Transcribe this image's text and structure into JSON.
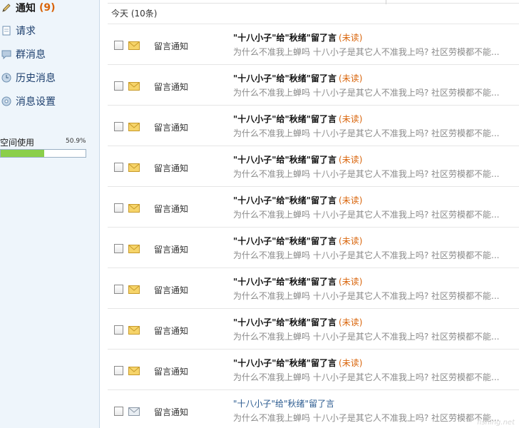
{
  "sidebar": {
    "items": [
      {
        "label": "通知",
        "count": "(9)",
        "icon": "pencil-icon"
      },
      {
        "label": "请求",
        "icon": "document-icon"
      },
      {
        "label": "群消息",
        "icon": "chat-icon"
      },
      {
        "label": "历史消息",
        "icon": "clock-icon"
      },
      {
        "label": "消息设置",
        "icon": "gear-icon"
      }
    ],
    "space": {
      "label": "空间使用",
      "percent_text": "50.9%",
      "percent": 50.9
    }
  },
  "main": {
    "group_title": "今天 (10条)",
    "rows": [
      {
        "type": "留言通知",
        "title": "\"十八小子\"给\"秋绪\"留了言",
        "status": "(未读)",
        "preview": "为什么不准我上蝉吗  十八小子是其它人不准我上吗? 社区劳模都不能...",
        "read": false
      },
      {
        "type": "留言通知",
        "title": "\"十八小子\"给\"秋绪\"留了言",
        "status": "(未读)",
        "preview": "为什么不准我上蝉吗  十八小子是其它人不准我上吗? 社区劳模都不能...",
        "read": false
      },
      {
        "type": "留言通知",
        "title": "\"十八小子\"给\"秋绪\"留了言",
        "status": "(未读)",
        "preview": "为什么不准我上蝉吗  十八小子是其它人不准我上吗? 社区劳模都不能...",
        "read": false
      },
      {
        "type": "留言通知",
        "title": "\"十八小子\"给\"秋绪\"留了言",
        "status": "(未读)",
        "preview": "为什么不准我上蝉吗  十八小子是其它人不准我上吗? 社区劳模都不能...",
        "read": false
      },
      {
        "type": "留言通知",
        "title": "\"十八小子\"给\"秋绪\"留了言",
        "status": "(未读)",
        "preview": "为什么不准我上蝉吗  十八小子是其它人不准我上吗? 社区劳模都不能...",
        "read": false
      },
      {
        "type": "留言通知",
        "title": "\"十八小子\"给\"秋绪\"留了言",
        "status": "(未读)",
        "preview": "为什么不准我上蝉吗  十八小子是其它人不准我上吗? 社区劳模都不能...",
        "read": false
      },
      {
        "type": "留言通知",
        "title": "\"十八小子\"给\"秋绪\"留了言",
        "status": "(未读)",
        "preview": "为什么不准我上蝉吗  十八小子是其它人不准我上吗? 社区劳模都不能...",
        "read": false
      },
      {
        "type": "留言通知",
        "title": "\"十八小子\"给\"秋绪\"留了言",
        "status": "(未读)",
        "preview": "为什么不准我上蝉吗  十八小子是其它人不准我上吗? 社区劳模都不能...",
        "read": false
      },
      {
        "type": "留言通知",
        "title": "\"十八小子\"给\"秋绪\"留了言",
        "status": "(未读)",
        "preview": "为什么不准我上蝉吗  十八小子是其它人不准我上吗? 社区劳模都不能...",
        "read": false
      },
      {
        "type": "留言通知",
        "title": "\"十八小子\"给\"秋绪\"留了言",
        "status": "",
        "preview": "为什么不准我上蝉吗  十八小子是其它人不准我上吗? 社区劳模都不能...",
        "read": true
      }
    ]
  },
  "colors": {
    "accent": "#d9640a",
    "link": "#2a5a8f",
    "sidebar_bg": "#eef5fb",
    "progress": "#8bcf4a"
  }
}
